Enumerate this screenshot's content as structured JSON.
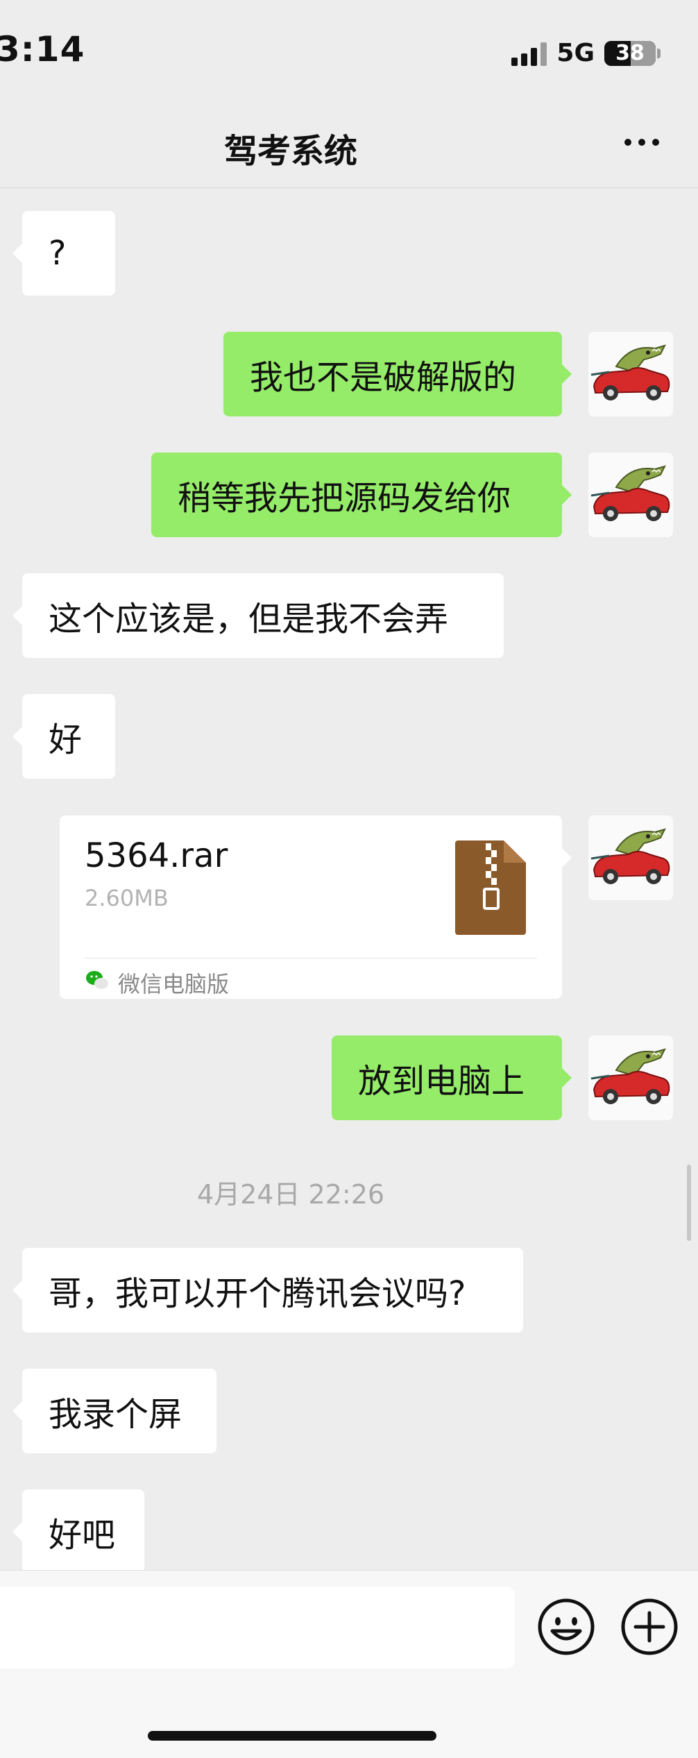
{
  "status_bar": {
    "time": "3:14",
    "network": "5G",
    "battery": "38"
  },
  "header": {
    "title": "驾考系统"
  },
  "messages": [
    {
      "side": "in",
      "text": "?"
    },
    {
      "side": "out",
      "text": "我也不是破解版的"
    },
    {
      "side": "out",
      "text": "稍等我先把源码发给你"
    },
    {
      "side": "in",
      "text": "这个应该是，但是我不会弄"
    },
    {
      "side": "in",
      "text": "好"
    },
    {
      "side": "out",
      "text": "放到电脑上"
    },
    {
      "side": "in",
      "text": "哥，我可以开个腾讯会议吗?"
    },
    {
      "side": "in",
      "text": "我录个屏"
    },
    {
      "side": "in",
      "text": "好吧"
    }
  ],
  "file": {
    "name": "5364.rar",
    "size": "2.60MB",
    "source": "微信电脑版"
  },
  "timestamp": "4月24日 22:26",
  "icons": {
    "more": "more-dots-icon",
    "emoji": "smiley-icon",
    "plus": "plus-circle-icon",
    "file": "zip-file-icon",
    "avatar": "crocodile-car-avatar"
  },
  "colors": {
    "outgoing_bubble": "#95ec69",
    "incoming_bubble": "#ffffff",
    "background": "#ededed",
    "file_icon": "#8b5a2b"
  }
}
